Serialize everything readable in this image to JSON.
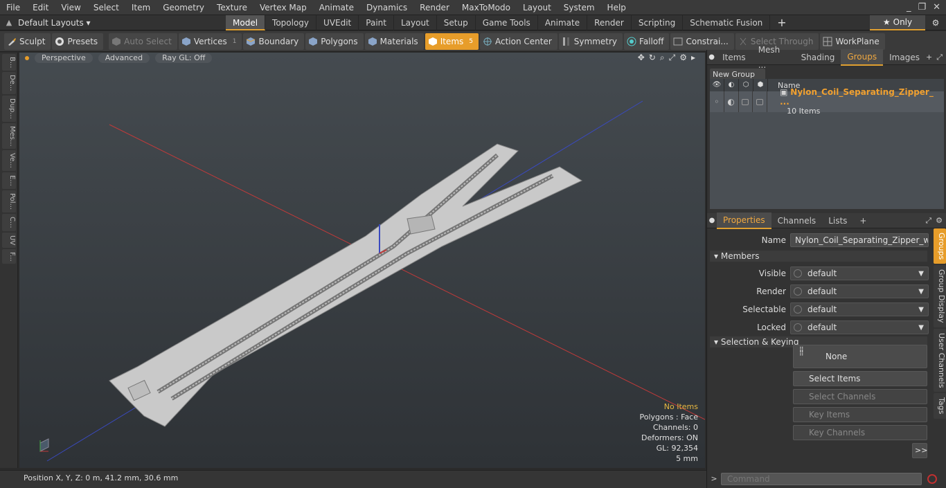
{
  "menu": [
    "File",
    "Edit",
    "View",
    "Select",
    "Item",
    "Geometry",
    "Texture",
    "Vertex Map",
    "Animate",
    "Dynamics",
    "Render",
    "MaxToModo",
    "Layout",
    "System",
    "Help"
  ],
  "window_controls": [
    "_",
    "❐",
    "✕"
  ],
  "layouts_label": "Default Layouts ▾",
  "mode_tabs": [
    {
      "label": "Model",
      "active": true
    },
    {
      "label": "Topology",
      "active": false
    },
    {
      "label": "UVEdit",
      "active": false
    },
    {
      "label": "Paint",
      "active": false
    },
    {
      "label": "Layout",
      "active": false
    },
    {
      "label": "Setup",
      "active": false
    },
    {
      "label": "Game Tools",
      "active": false
    },
    {
      "label": "Animate",
      "active": false
    },
    {
      "label": "Render",
      "active": false
    },
    {
      "label": "Scripting",
      "active": false
    },
    {
      "label": "Schematic Fusion",
      "active": false
    }
  ],
  "only_label": "Only",
  "toolbar": {
    "sculpt": "Sculpt",
    "presets": "Presets",
    "auto_select": "Auto Select",
    "vertices": "Vertices",
    "vertices_count": "1",
    "boundary": "Boundary",
    "polygons": "Polygons",
    "materials": "Materials",
    "items": "Items",
    "items_count": "5",
    "action_center": "Action Center",
    "symmetry": "Symmetry",
    "falloff": "Falloff",
    "constraints": "Constrai...",
    "select_through": "Select Through",
    "workplane": "WorkPlane"
  },
  "left_tabs": [
    "B...",
    "De...",
    "Dup...",
    "Mes...",
    "Ve...",
    "E...",
    "Pol...",
    "C...",
    "UV",
    "F..."
  ],
  "viewport": {
    "view": "Perspective",
    "shading": "Advanced",
    "raygl": "Ray GL: Off",
    "info": {
      "items": "No Items",
      "polygons": "Polygons : Face",
      "channels": "Channels: 0",
      "deformers": "Deformers: ON",
      "gl": "GL: 92,354",
      "scale": "5 mm"
    }
  },
  "status": {
    "position": "Position X, Y, Z:   0 m, 41.2 mm, 30.6 mm"
  },
  "top_panel_tabs": [
    {
      "label": "Items",
      "active": false
    },
    {
      "label": "Mesh ...",
      "active": false
    },
    {
      "label": "Shading",
      "active": false
    },
    {
      "label": "Groups",
      "active": true
    },
    {
      "label": "Images",
      "active": false
    }
  ],
  "groups": {
    "new_group": "New Group",
    "col_name": "Name",
    "row": {
      "name": "Nylon_Coil_Separating_Zipper_ ...",
      "sub": "10 Items"
    }
  },
  "bottom_panel_tabs": [
    {
      "label": "Properties",
      "active": true
    },
    {
      "label": "Channels",
      "active": false
    },
    {
      "label": "Lists",
      "active": false
    }
  ],
  "properties": {
    "name_label": "Name",
    "name_value": "Nylon_Coil_Separating_Zipper_with_S",
    "members": "Members",
    "visible_label": "Visible",
    "visible_value": "default",
    "render_label": "Render",
    "render_value": "default",
    "selectable_label": "Selectable",
    "selectable_value": "default",
    "locked_label": "Locked",
    "locked_value": "default",
    "selection_keying": "Selection & Keying",
    "none": "None",
    "select_items": "Select Items",
    "select_channels": "Select Channels",
    "key_items": "Key Items",
    "key_channels": "Key Channels",
    "more": ">>"
  },
  "side_tabs": [
    {
      "label": "Groups",
      "active": true
    },
    {
      "label": "Group Display",
      "active": false
    },
    {
      "label": "User Channels",
      "active": false
    },
    {
      "label": "Tags",
      "active": false
    }
  ],
  "command": {
    "prompt": ">",
    "placeholder": "Command"
  },
  "colors": {
    "accent": "#e79d2a",
    "group_name": "#f0a030",
    "axis_x": "#c03a3a",
    "axis_z": "#3a4ac0"
  }
}
